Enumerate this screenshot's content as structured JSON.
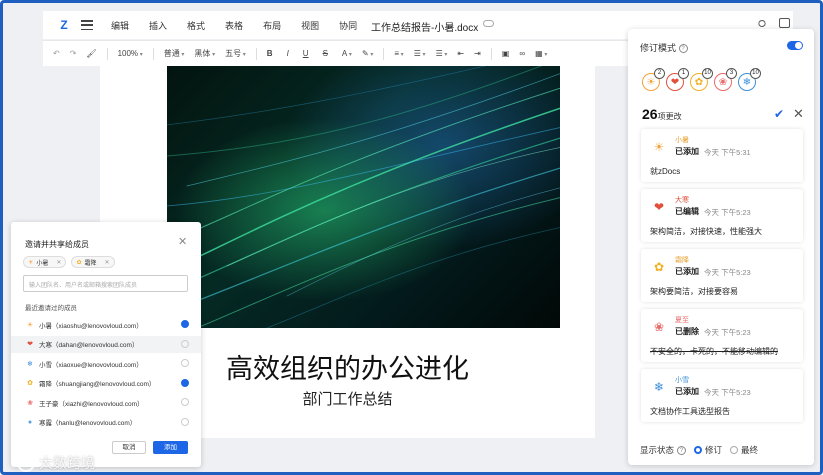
{
  "menubar": {
    "items": [
      "编辑",
      "插入",
      "格式",
      "表格",
      "布局",
      "视图",
      "协同"
    ],
    "doc_title": "工作总结报告-小暑.docx"
  },
  "toolbar": {
    "zoom": "100%",
    "style": "普通",
    "font": "黑体",
    "size": "五号"
  },
  "page": {
    "title": "高效组织的办公进化",
    "subtitle": "部门工作总结"
  },
  "revision": {
    "mode_label": "修订模式",
    "mode_on": true,
    "avatars": [
      {
        "icon": "sun-avatar-icon",
        "glyph": "☀",
        "color": "#f3a23a",
        "badge": "2"
      },
      {
        "icon": "bird-avatar-icon",
        "glyph": "❤",
        "color": "#e0503a",
        "badge": "1"
      },
      {
        "icon": "leaf-avatar-icon",
        "glyph": "✿",
        "color": "#f0b020",
        "badge": "10"
      },
      {
        "icon": "lotus-avatar-icon",
        "glyph": "❀",
        "color": "#e86a6a",
        "badge": "3"
      },
      {
        "icon": "snowflake-avatar-icon",
        "glyph": "❄",
        "color": "#3c8fd8",
        "badge": "10"
      }
    ],
    "count": "26",
    "count_suffix": "项更改",
    "changes": [
      {
        "user": "小暑",
        "user_color": "#e8a030",
        "icon": "sun-icon",
        "glyph": "☀",
        "glyph_color": "#f3a23a",
        "action": "已添加",
        "time": "今天 下午5:31",
        "text": "就zDocs",
        "strike": false
      },
      {
        "user": "大寒",
        "user_color": "#e0503a",
        "icon": "bird-icon",
        "glyph": "❤",
        "glyph_color": "#e0503a",
        "action": "已编辑",
        "time": "今天 下午5:23",
        "text": "架构简洁，对接快速，性能强大",
        "strike": false
      },
      {
        "user": "霜降",
        "user_color": "#e8a030",
        "icon": "leaf-icon",
        "glyph": "✿",
        "glyph_color": "#f0b020",
        "action": "已添加",
        "time": "今天 下午5:23",
        "text": "架构要简洁，对接要容易",
        "strike": false
      },
      {
        "user": "夏至",
        "user_color": "#e86a6a",
        "icon": "lotus-icon",
        "glyph": "❀",
        "glyph_color": "#e86a6a",
        "action": "已删除",
        "time": "今天 下午5:23",
        "text": "不安全的，卡死的，不能移动编辑的",
        "strike": true
      },
      {
        "user": "小雪",
        "user_color": "#3c8fd8",
        "icon": "snowflake-icon",
        "glyph": "❄",
        "glyph_color": "#3c8fd8",
        "action": "已添加",
        "time": "今天 下午5:23",
        "text": "文档协作工具选型报告",
        "strike": false
      }
    ],
    "footer_label": "显示状态",
    "options": [
      {
        "label": "修订",
        "selected": true
      },
      {
        "label": "最终",
        "selected": false
      }
    ]
  },
  "invite": {
    "title": "邀请并共享给成员",
    "tags": [
      {
        "label": "小暑",
        "glyph": "☀",
        "color": "#f3a23a"
      },
      {
        "label": "霜降",
        "glyph": "✿",
        "color": "#f0b020"
      }
    ],
    "placeholder": "输入团队名、用户名或邮箱搜索团队成员",
    "recent_label": "最近邀请过的成员",
    "members": [
      {
        "label": "小暑（xiaoshu@lenovovloud.com）",
        "glyph": "☀",
        "color": "#f3a23a",
        "checked": true
      },
      {
        "label": "大寒（dahan@lenovovloud.com）",
        "glyph": "❤",
        "color": "#e0503a",
        "checked": false
      },
      {
        "label": "小雪（xiaoxue@lenovovloud.com）",
        "glyph": "❄",
        "color": "#3c8fd8",
        "checked": false
      },
      {
        "label": "霜降（shuangjiang@lenovovloud.com）",
        "glyph": "✿",
        "color": "#f0b020",
        "checked": true
      },
      {
        "label": "王子豪（xiazhi@lenovovloud.com）",
        "glyph": "❀",
        "color": "#e86a6a",
        "checked": false
      },
      {
        "label": "寒露（hanlu@lenovovloud.com）",
        "glyph": "●",
        "color": "#5aa0e0",
        "checked": false
      }
    ],
    "cancel_label": "取消",
    "add_label": "添加"
  },
  "watermark": "大数跨境"
}
